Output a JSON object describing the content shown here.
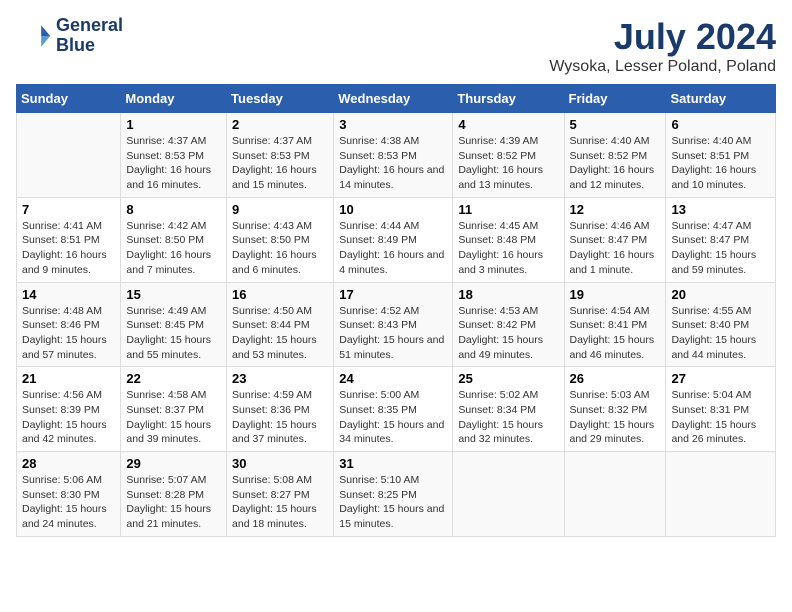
{
  "logo": {
    "line1": "General",
    "line2": "Blue"
  },
  "title": "July 2024",
  "subtitle": "Wysoka, Lesser Poland, Poland",
  "weekdays": [
    "Sunday",
    "Monday",
    "Tuesday",
    "Wednesday",
    "Thursday",
    "Friday",
    "Saturday"
  ],
  "weeks": [
    [
      {
        "day": "",
        "sunrise": "",
        "sunset": "",
        "daylight": ""
      },
      {
        "day": "1",
        "sunrise": "Sunrise: 4:37 AM",
        "sunset": "Sunset: 8:53 PM",
        "daylight": "Daylight: 16 hours and 16 minutes."
      },
      {
        "day": "2",
        "sunrise": "Sunrise: 4:37 AM",
        "sunset": "Sunset: 8:53 PM",
        "daylight": "Daylight: 16 hours and 15 minutes."
      },
      {
        "day": "3",
        "sunrise": "Sunrise: 4:38 AM",
        "sunset": "Sunset: 8:53 PM",
        "daylight": "Daylight: 16 hours and 14 minutes."
      },
      {
        "day": "4",
        "sunrise": "Sunrise: 4:39 AM",
        "sunset": "Sunset: 8:52 PM",
        "daylight": "Daylight: 16 hours and 13 minutes."
      },
      {
        "day": "5",
        "sunrise": "Sunrise: 4:40 AM",
        "sunset": "Sunset: 8:52 PM",
        "daylight": "Daylight: 16 hours and 12 minutes."
      },
      {
        "day": "6",
        "sunrise": "Sunrise: 4:40 AM",
        "sunset": "Sunset: 8:51 PM",
        "daylight": "Daylight: 16 hours and 10 minutes."
      }
    ],
    [
      {
        "day": "7",
        "sunrise": "Sunrise: 4:41 AM",
        "sunset": "Sunset: 8:51 PM",
        "daylight": "Daylight: 16 hours and 9 minutes."
      },
      {
        "day": "8",
        "sunrise": "Sunrise: 4:42 AM",
        "sunset": "Sunset: 8:50 PM",
        "daylight": "Daylight: 16 hours and 7 minutes."
      },
      {
        "day": "9",
        "sunrise": "Sunrise: 4:43 AM",
        "sunset": "Sunset: 8:50 PM",
        "daylight": "Daylight: 16 hours and 6 minutes."
      },
      {
        "day": "10",
        "sunrise": "Sunrise: 4:44 AM",
        "sunset": "Sunset: 8:49 PM",
        "daylight": "Daylight: 16 hours and 4 minutes."
      },
      {
        "day": "11",
        "sunrise": "Sunrise: 4:45 AM",
        "sunset": "Sunset: 8:48 PM",
        "daylight": "Daylight: 16 hours and 3 minutes."
      },
      {
        "day": "12",
        "sunrise": "Sunrise: 4:46 AM",
        "sunset": "Sunset: 8:47 PM",
        "daylight": "Daylight: 16 hours and 1 minute."
      },
      {
        "day": "13",
        "sunrise": "Sunrise: 4:47 AM",
        "sunset": "Sunset: 8:47 PM",
        "daylight": "Daylight: 15 hours and 59 minutes."
      }
    ],
    [
      {
        "day": "14",
        "sunrise": "Sunrise: 4:48 AM",
        "sunset": "Sunset: 8:46 PM",
        "daylight": "Daylight: 15 hours and 57 minutes."
      },
      {
        "day": "15",
        "sunrise": "Sunrise: 4:49 AM",
        "sunset": "Sunset: 8:45 PM",
        "daylight": "Daylight: 15 hours and 55 minutes."
      },
      {
        "day": "16",
        "sunrise": "Sunrise: 4:50 AM",
        "sunset": "Sunset: 8:44 PM",
        "daylight": "Daylight: 15 hours and 53 minutes."
      },
      {
        "day": "17",
        "sunrise": "Sunrise: 4:52 AM",
        "sunset": "Sunset: 8:43 PM",
        "daylight": "Daylight: 15 hours and 51 minutes."
      },
      {
        "day": "18",
        "sunrise": "Sunrise: 4:53 AM",
        "sunset": "Sunset: 8:42 PM",
        "daylight": "Daylight: 15 hours and 49 minutes."
      },
      {
        "day": "19",
        "sunrise": "Sunrise: 4:54 AM",
        "sunset": "Sunset: 8:41 PM",
        "daylight": "Daylight: 15 hours and 46 minutes."
      },
      {
        "day": "20",
        "sunrise": "Sunrise: 4:55 AM",
        "sunset": "Sunset: 8:40 PM",
        "daylight": "Daylight: 15 hours and 44 minutes."
      }
    ],
    [
      {
        "day": "21",
        "sunrise": "Sunrise: 4:56 AM",
        "sunset": "Sunset: 8:39 PM",
        "daylight": "Daylight: 15 hours and 42 minutes."
      },
      {
        "day": "22",
        "sunrise": "Sunrise: 4:58 AM",
        "sunset": "Sunset: 8:37 PM",
        "daylight": "Daylight: 15 hours and 39 minutes."
      },
      {
        "day": "23",
        "sunrise": "Sunrise: 4:59 AM",
        "sunset": "Sunset: 8:36 PM",
        "daylight": "Daylight: 15 hours and 37 minutes."
      },
      {
        "day": "24",
        "sunrise": "Sunrise: 5:00 AM",
        "sunset": "Sunset: 8:35 PM",
        "daylight": "Daylight: 15 hours and 34 minutes."
      },
      {
        "day": "25",
        "sunrise": "Sunrise: 5:02 AM",
        "sunset": "Sunset: 8:34 PM",
        "daylight": "Daylight: 15 hours and 32 minutes."
      },
      {
        "day": "26",
        "sunrise": "Sunrise: 5:03 AM",
        "sunset": "Sunset: 8:32 PM",
        "daylight": "Daylight: 15 hours and 29 minutes."
      },
      {
        "day": "27",
        "sunrise": "Sunrise: 5:04 AM",
        "sunset": "Sunset: 8:31 PM",
        "daylight": "Daylight: 15 hours and 26 minutes."
      }
    ],
    [
      {
        "day": "28",
        "sunrise": "Sunrise: 5:06 AM",
        "sunset": "Sunset: 8:30 PM",
        "daylight": "Daylight: 15 hours and 24 minutes."
      },
      {
        "day": "29",
        "sunrise": "Sunrise: 5:07 AM",
        "sunset": "Sunset: 8:28 PM",
        "daylight": "Daylight: 15 hours and 21 minutes."
      },
      {
        "day": "30",
        "sunrise": "Sunrise: 5:08 AM",
        "sunset": "Sunset: 8:27 PM",
        "daylight": "Daylight: 15 hours and 18 minutes."
      },
      {
        "day": "31",
        "sunrise": "Sunrise: 5:10 AM",
        "sunset": "Sunset: 8:25 PM",
        "daylight": "Daylight: 15 hours and 15 minutes."
      },
      {
        "day": "",
        "sunrise": "",
        "sunset": "",
        "daylight": ""
      },
      {
        "day": "",
        "sunrise": "",
        "sunset": "",
        "daylight": ""
      },
      {
        "day": "",
        "sunrise": "",
        "sunset": "",
        "daylight": ""
      }
    ]
  ]
}
